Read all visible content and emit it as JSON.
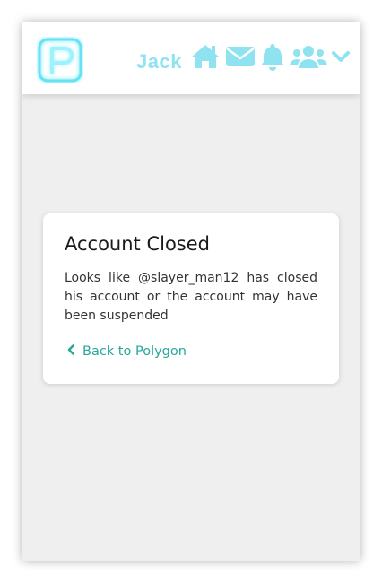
{
  "header": {
    "user_name": "Jack",
    "icons": [
      "home-icon",
      "mail-icon",
      "bell-icon",
      "users-icon",
      "chevron-down-icon"
    ],
    "accent_color": "#8fe3f0"
  },
  "card": {
    "title": "Account Closed",
    "message": "Looks like @slayer_man12 has closed his account or the account may have been suspended",
    "back_link": "Back to Polygon",
    "link_color": "#27a89a"
  }
}
